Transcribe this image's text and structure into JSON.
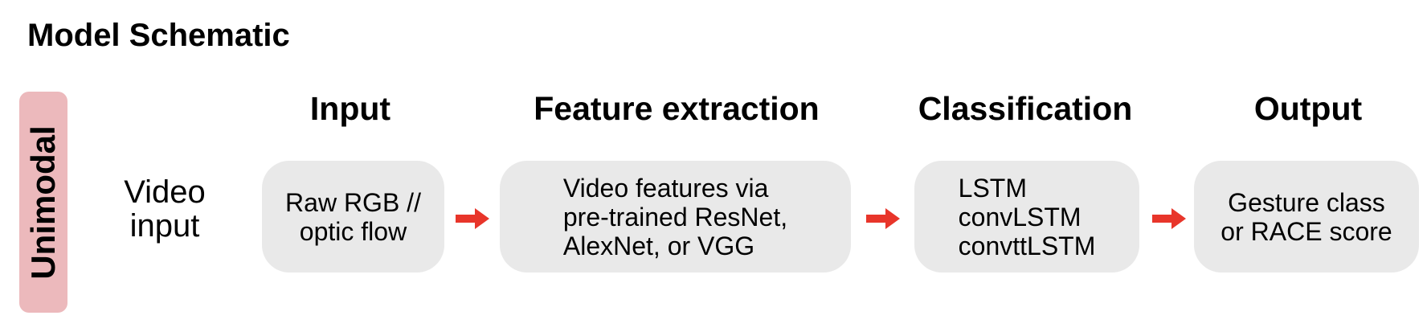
{
  "title": "Model Schematic",
  "row_tag": "Unimodal",
  "row_label": [
    "Video",
    "input"
  ],
  "columns": [
    {
      "header": "Input",
      "lines": [
        "Raw RGB //",
        "optic flow"
      ]
    },
    {
      "header": "Feature extraction",
      "lines": [
        "Video features via",
        "pre-trained ResNet,",
        "AlexNet, or VGG"
      ]
    },
    {
      "header": "Classification",
      "lines": [
        "LSTM",
        "convLSTM",
        "convttLSTM"
      ]
    },
    {
      "header": "Output",
      "lines": [
        "Gesture class",
        "or RACE score"
      ]
    }
  ],
  "colors": {
    "tag_background": "#ecb9bc",
    "box_background": "#e9e9e9",
    "arrow": "#e8352a"
  }
}
